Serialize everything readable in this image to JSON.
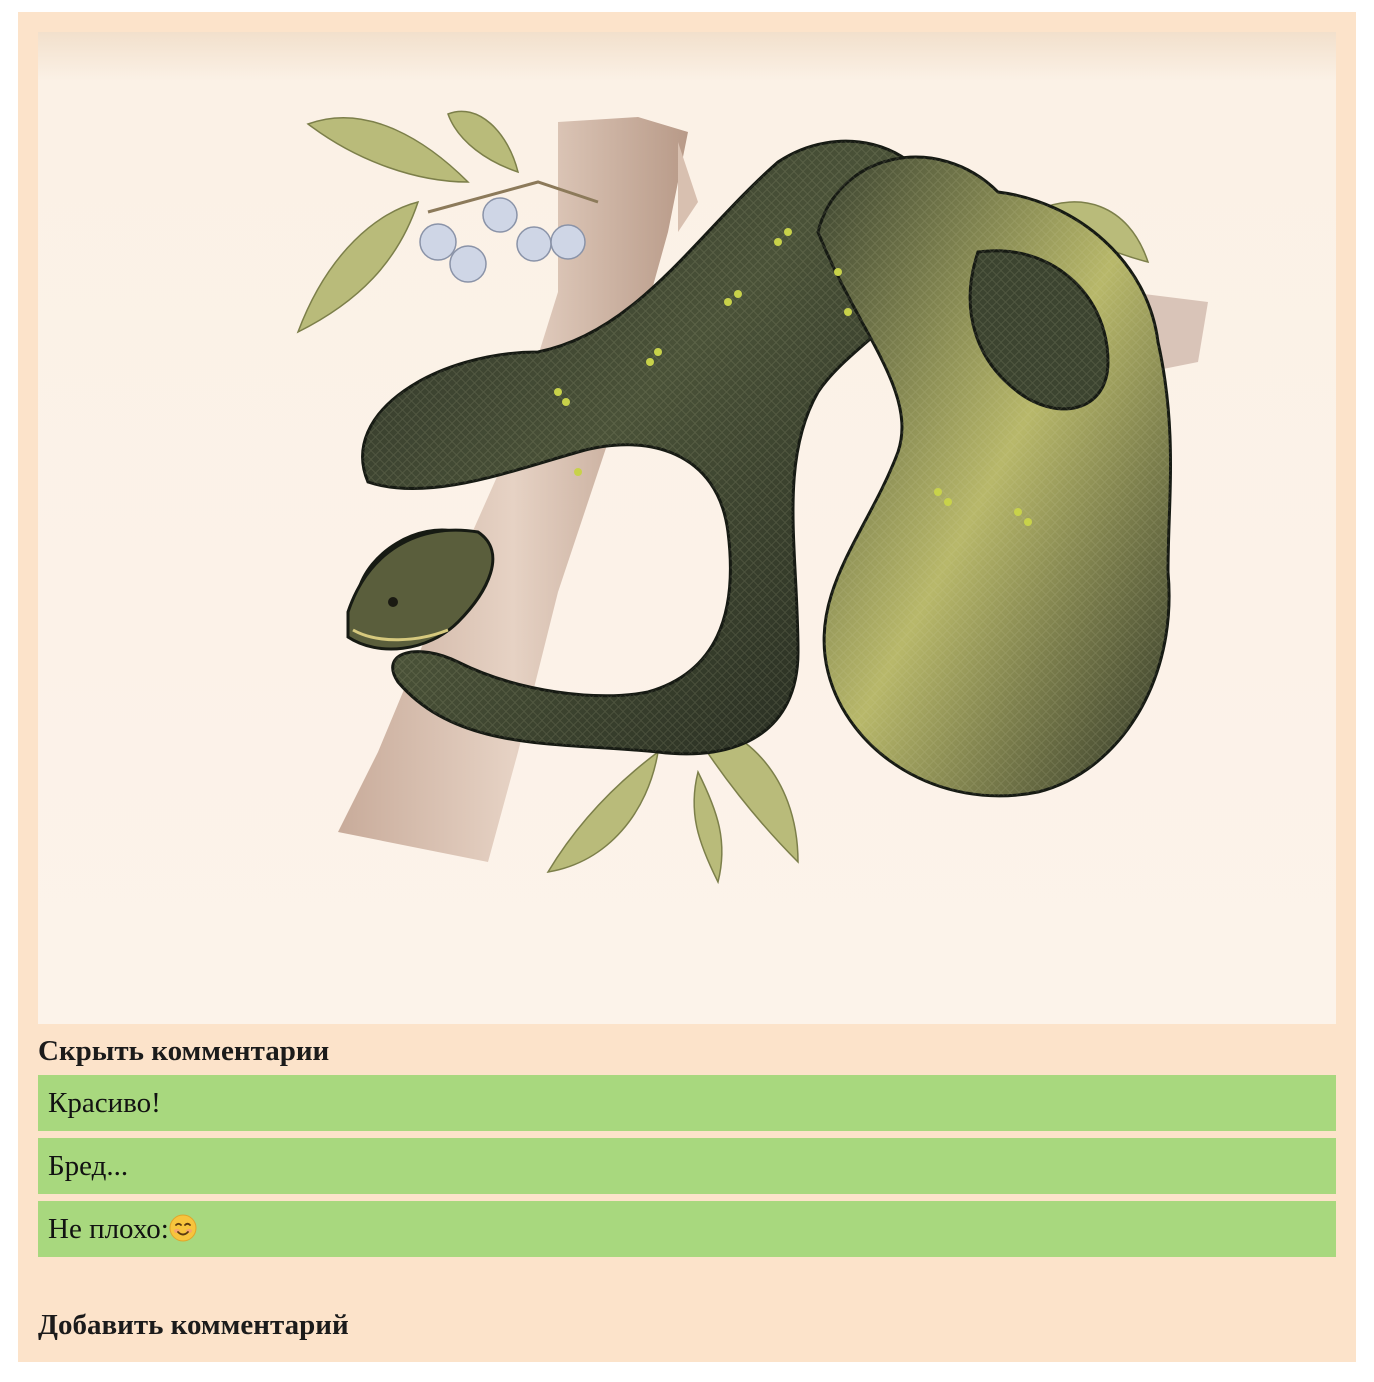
{
  "picture": {
    "alt": "snake illustration"
  },
  "comments_section": {
    "toggle_label": "Скрыть комментарии",
    "comments": [
      {
        "text": "Красиво!"
      },
      {
        "text": "Бред..."
      },
      {
        "text": "Не плохо:"
      }
    ],
    "add_label": "Добавить комментарий"
  },
  "colors": {
    "card_background": "#fce3ca",
    "comment_background": "#a8d87e"
  }
}
